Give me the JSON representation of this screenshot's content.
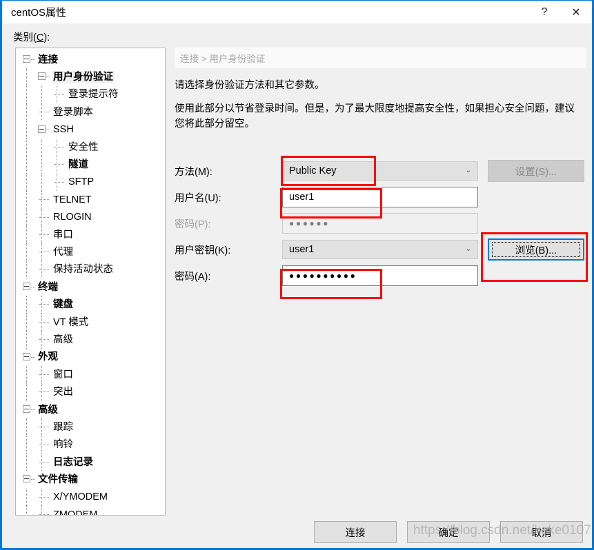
{
  "window": {
    "title": "centOS属性",
    "help_icon": "?",
    "close_icon": "✕",
    "accent_color": "#0078d7",
    "annotation_color": "#ff0000"
  },
  "category": {
    "label_pre": "类别(",
    "label_key": "C",
    "label_post": "):"
  },
  "tree": {
    "items": [
      {
        "label": "连接",
        "level": 0,
        "bold": true,
        "selected": false,
        "expander": true
      },
      {
        "label": "用户身份验证",
        "level": 1,
        "bold": true,
        "selected": true,
        "expander": true
      },
      {
        "label": "登录提示符",
        "level": 2,
        "bold": false,
        "selected": false,
        "expander": false
      },
      {
        "label": "登录脚本",
        "level": 1,
        "bold": false,
        "selected": false,
        "expander": false
      },
      {
        "label": "SSH",
        "level": 1,
        "bold": false,
        "selected": false,
        "expander": true
      },
      {
        "label": "安全性",
        "level": 2,
        "bold": false,
        "selected": false,
        "expander": false
      },
      {
        "label": "隧道",
        "level": 2,
        "bold": true,
        "selected": false,
        "expander": false
      },
      {
        "label": "SFTP",
        "level": 2,
        "bold": false,
        "selected": false,
        "expander": false
      },
      {
        "label": "TELNET",
        "level": 1,
        "bold": false,
        "selected": false,
        "expander": false
      },
      {
        "label": "RLOGIN",
        "level": 1,
        "bold": false,
        "selected": false,
        "expander": false
      },
      {
        "label": "串口",
        "level": 1,
        "bold": false,
        "selected": false,
        "expander": false
      },
      {
        "label": "代理",
        "level": 1,
        "bold": false,
        "selected": false,
        "expander": false
      },
      {
        "label": "保持活动状态",
        "level": 1,
        "bold": false,
        "selected": false,
        "expander": false
      },
      {
        "label": "终端",
        "level": 0,
        "bold": true,
        "selected": false,
        "expander": true
      },
      {
        "label": "键盘",
        "level": 1,
        "bold": true,
        "selected": false,
        "expander": false
      },
      {
        "label": "VT 模式",
        "level": 1,
        "bold": false,
        "selected": false,
        "expander": false
      },
      {
        "label": "高级",
        "level": 1,
        "bold": false,
        "selected": false,
        "expander": false
      },
      {
        "label": "外观",
        "level": 0,
        "bold": true,
        "selected": false,
        "expander": true
      },
      {
        "label": "窗口",
        "level": 1,
        "bold": false,
        "selected": false,
        "expander": false
      },
      {
        "label": "突出",
        "level": 1,
        "bold": false,
        "selected": false,
        "expander": false
      },
      {
        "label": "高级",
        "level": 0,
        "bold": true,
        "selected": false,
        "expander": true
      },
      {
        "label": "跟踪",
        "level": 1,
        "bold": false,
        "selected": false,
        "expander": false
      },
      {
        "label": "响铃",
        "level": 1,
        "bold": false,
        "selected": false,
        "expander": false
      },
      {
        "label": "日志记录",
        "level": 1,
        "bold": true,
        "selected": false,
        "expander": false
      },
      {
        "label": "文件传输",
        "level": 0,
        "bold": true,
        "selected": false,
        "expander": true
      },
      {
        "label": "X/YMODEM",
        "level": 1,
        "bold": false,
        "selected": false,
        "expander": false
      },
      {
        "label": "ZMODEM",
        "level": 1,
        "bold": false,
        "selected": false,
        "expander": false
      }
    ]
  },
  "content": {
    "breadcrumb": "连接  >  用户身份验证",
    "desc1": "请选择身份验证方法和其它参数。",
    "desc2": "使用此部分以节省登录时间。但是，为了最大限度地提高安全性，如果担心安全问题，建议您将此部分留空。"
  },
  "form": {
    "method": {
      "label": "方法(M):",
      "value": "Public Key",
      "chevron": "⌄",
      "settings_button": "设置(S)..."
    },
    "username": {
      "label": "用户名(U):",
      "value": "user1"
    },
    "password_disabled": {
      "label": "密码(P):",
      "value": "●●●●●●"
    },
    "userkey": {
      "label": "用户密钥(K):",
      "value": "user1",
      "chevron": "⌄",
      "browse_button": "浏览(B)..."
    },
    "passphrase": {
      "label": "密码(A):",
      "value": "●●●●●●●●●●"
    }
  },
  "footer": {
    "connect": "连接",
    "ok": "确定",
    "cancel": "取消"
  },
  "watermark": "https://blog.csdn.net/keke0107"
}
